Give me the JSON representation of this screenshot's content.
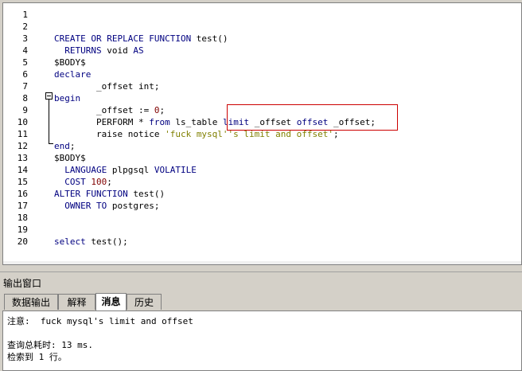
{
  "editor": {
    "lines": [
      {
        "n": "1",
        "t": []
      },
      {
        "n": "2",
        "t": []
      },
      {
        "n": "3",
        "t": [
          {
            "c": "kw",
            "s": "CREATE OR REPLACE FUNCTION"
          },
          {
            "c": "",
            "s": " test()"
          }
        ]
      },
      {
        "n": "4",
        "t": [
          {
            "c": "",
            "s": "  "
          },
          {
            "c": "kw",
            "s": "RETURNS"
          },
          {
            "c": "",
            "s": " void "
          },
          {
            "c": "kw",
            "s": "AS"
          }
        ]
      },
      {
        "n": "5",
        "t": [
          {
            "c": "",
            "s": "$BODY$"
          }
        ]
      },
      {
        "n": "6",
        "t": [
          {
            "c": "kw",
            "s": "declare"
          }
        ]
      },
      {
        "n": "7",
        "t": [
          {
            "c": "",
            "s": "        _offset int;"
          }
        ]
      },
      {
        "n": "8",
        "t": [
          {
            "c": "kw",
            "s": "begin"
          }
        ]
      },
      {
        "n": "9",
        "t": [
          {
            "c": "",
            "s": "        _offset := "
          },
          {
            "c": "num",
            "s": "0"
          },
          {
            "c": "",
            "s": ";"
          }
        ]
      },
      {
        "n": "10",
        "t": [
          {
            "c": "",
            "s": "        PERFORM * "
          },
          {
            "c": "kw",
            "s": "from"
          },
          {
            "c": "",
            "s": " ls_table "
          },
          {
            "c": "kw",
            "s": "limit"
          },
          {
            "c": "",
            "s": " _offset "
          },
          {
            "c": "kw",
            "s": "offset"
          },
          {
            "c": "",
            "s": " _offset;"
          }
        ]
      },
      {
        "n": "11",
        "t": [
          {
            "c": "",
            "s": "        raise notice "
          },
          {
            "c": "str",
            "s": "'fuck mysql''s limit and offset'"
          },
          {
            "c": "",
            "s": ";"
          }
        ]
      },
      {
        "n": "12",
        "t": [
          {
            "c": "kw",
            "s": "end"
          },
          {
            "c": "",
            "s": ";"
          }
        ]
      },
      {
        "n": "13",
        "t": [
          {
            "c": "",
            "s": "$BODY$"
          }
        ]
      },
      {
        "n": "14",
        "t": [
          {
            "c": "",
            "s": "  "
          },
          {
            "c": "kw",
            "s": "LANGUAGE"
          },
          {
            "c": "",
            "s": " plpgsql "
          },
          {
            "c": "kw",
            "s": "VOLATILE"
          }
        ]
      },
      {
        "n": "15",
        "t": [
          {
            "c": "",
            "s": "  "
          },
          {
            "c": "kw",
            "s": "COST"
          },
          {
            "c": "",
            "s": " "
          },
          {
            "c": "num",
            "s": "100"
          },
          {
            "c": "",
            "s": ";"
          }
        ]
      },
      {
        "n": "16",
        "t": [
          {
            "c": "kw",
            "s": "ALTER FUNCTION"
          },
          {
            "c": "",
            "s": " test()"
          }
        ]
      },
      {
        "n": "17",
        "t": [
          {
            "c": "",
            "s": "  "
          },
          {
            "c": "kw",
            "s": "OWNER TO"
          },
          {
            "c": "",
            "s": " postgres;"
          }
        ]
      },
      {
        "n": "18",
        "t": []
      },
      {
        "n": "19",
        "t": []
      },
      {
        "n": "20",
        "t": [
          {
            "c": "kw",
            "s": "select"
          },
          {
            "c": "",
            "s": " test();"
          }
        ]
      }
    ]
  },
  "output_panel": {
    "title": "输出窗口",
    "tabs": [
      {
        "label": "数据输出",
        "active": false
      },
      {
        "label": "解释",
        "active": false
      },
      {
        "label": "消息",
        "active": true
      },
      {
        "label": "历史",
        "active": false
      }
    ],
    "messages": [
      "注意:  fuck mysql's limit and offset",
      "",
      "查询总耗时: 13 ms.",
      "检索到 1 行。"
    ]
  }
}
